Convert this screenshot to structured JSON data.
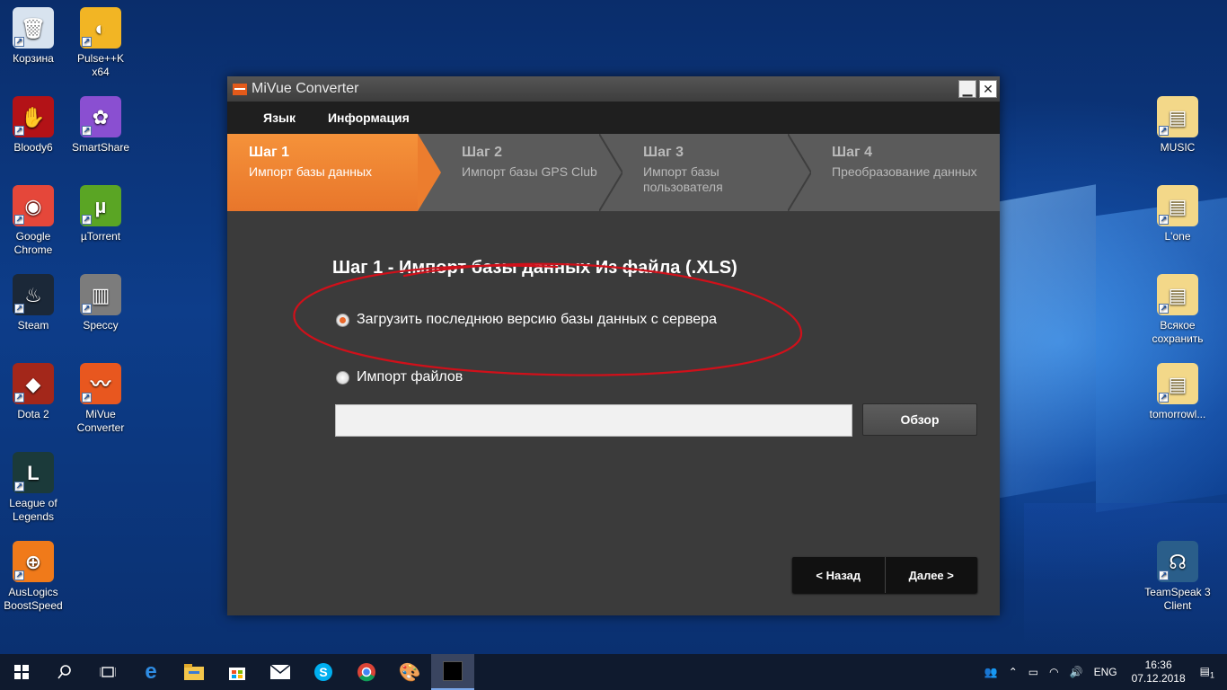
{
  "desktop": {
    "icons_left": [
      {
        "label": "Корзина",
        "glyph": "🗑",
        "bg": "#d8e3ef"
      },
      {
        "label": "Pulse++K x64",
        "glyph": "◐",
        "bg": "#f2b524"
      },
      {
        "label": "Bloody6",
        "glyph": "✋",
        "bg": "#b31217"
      },
      {
        "label": "SmartShare",
        "glyph": "✿",
        "bg": "#8a4fd1"
      },
      {
        "label": "Google Chrome",
        "glyph": "◉",
        "bg": "#e5473a"
      },
      {
        "label": "µTorrent",
        "glyph": "µ",
        "bg": "#5aa524"
      },
      {
        "label": "Steam",
        "glyph": "♨",
        "bg": "#1b2838"
      },
      {
        "label": "Speccy",
        "glyph": "▥",
        "bg": "#7c7c7c"
      },
      {
        "label": "Dota 2",
        "glyph": "◆",
        "bg": "#a3271a"
      },
      {
        "label": "MiVue Converter",
        "glyph": "〰",
        "bg": "#e8571f"
      },
      {
        "label": "League of Legends",
        "glyph": "L",
        "bg": "#1b3a3a"
      },
      {
        "label": "AusLogics BoostSpeed",
        "glyph": "⊕",
        "bg": "#f07a1a"
      }
    ],
    "icons_right": [
      {
        "label": "MUSIC",
        "glyph": "▤",
        "bg": "#f3d889"
      },
      {
        "label": "L'one",
        "glyph": "▤",
        "bg": "#f3d889"
      },
      {
        "label": "Всякое сохранить",
        "glyph": "▤",
        "bg": "#f3d889"
      },
      {
        "label": "tomorrowl...",
        "glyph": "▤",
        "bg": "#f3d889"
      },
      {
        "label": "TeamSpeak 3 Client",
        "glyph": "☊",
        "bg": "#2a5e8a"
      }
    ]
  },
  "window": {
    "title": "MiVue Converter",
    "minimize_label": "▁",
    "close_label": "✕",
    "menu": [
      "Язык",
      "Информация"
    ],
    "steps": [
      {
        "num": "Шаг 1",
        "desc": "Импорт базы данных"
      },
      {
        "num": "Шаг 2",
        "desc": "Импорт базы GPS Club"
      },
      {
        "num": "Шаг 3",
        "desc": "Импорт базы пользователя"
      },
      {
        "num": "Шаг 4",
        "desc": "Преобразование данных"
      }
    ],
    "heading": "Шаг 1 - Импорт базы данных Из файла (.XLS)",
    "option_server": "Загрузить последнюю версию базы данных с сервера",
    "option_files": "Импорт файлов",
    "file_path_value": "",
    "browse_label": "Обзор",
    "back_label": "< Назад",
    "next_label": "Далее  >",
    "accent_color": "#ec7d2e",
    "annotation_color": "#d0101a"
  },
  "taskbar": {
    "items": [
      "start-icon",
      "search-icon",
      "task-view-icon",
      "edge-icon",
      "explorer-icon",
      "store-icon",
      "mail-icon",
      "skype-icon",
      "chrome-icon",
      "paint-icon",
      "mivue-icon"
    ],
    "language": "ENG",
    "time": "16:36",
    "date": "07.12.2018",
    "notifications": "1"
  }
}
